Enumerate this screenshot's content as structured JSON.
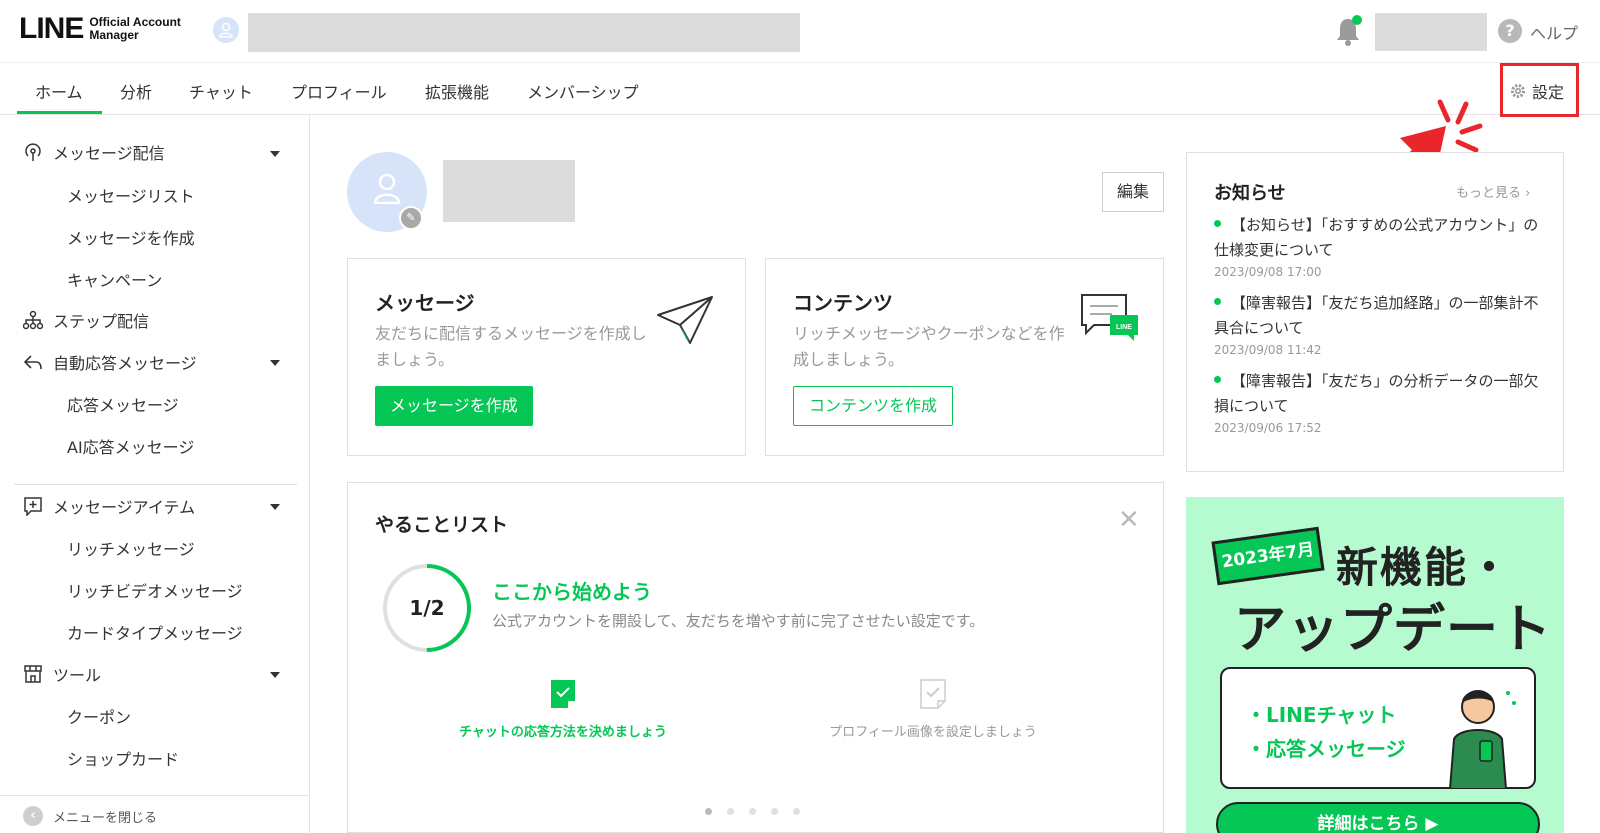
{
  "header": {
    "logo_main": "LINE",
    "logo_sub": "Official Account Manager",
    "help_label": "ヘルプ"
  },
  "tabs": [
    {
      "label": "ホーム",
      "active": true
    },
    {
      "label": "分析"
    },
    {
      "label": "チャット"
    },
    {
      "label": "プロフィール"
    },
    {
      "label": "拡張機能"
    },
    {
      "label": "メンバーシップ"
    }
  ],
  "settings_label": "設定",
  "sidebar": {
    "groups": [
      {
        "label": "メッセージ配信",
        "icon": "broadcast-icon",
        "items": [
          "メッセージリスト",
          "メッセージを作成",
          "キャンペーン"
        ]
      },
      {
        "label": "ステップ配信",
        "icon": "step-icon"
      },
      {
        "label": "自動応答メッセージ",
        "icon": "auto-reply-icon",
        "items": [
          "応答メッセージ",
          "AI応答メッセージ"
        ]
      },
      {
        "label": "メッセージアイテム",
        "icon": "add-item-icon",
        "items": [
          "リッチメッセージ",
          "リッチビデオメッセージ",
          "カードタイプメッセージ"
        ]
      },
      {
        "label": "ツール",
        "icon": "shop-icon",
        "items": [
          "クーポン",
          "ショップカード"
        ]
      }
    ],
    "close_menu": "メニューを閉じる"
  },
  "profile": {
    "edit_label": "編集"
  },
  "cards": {
    "message": {
      "title": "メッセージ",
      "desc": "友だちに配信するメッセージを作成しましょう。",
      "button": "メッセージを作成"
    },
    "content": {
      "title": "コンテンツ",
      "desc": "リッチメッセージやクーポンなどを作成しましょう。",
      "button": "コンテンツを作成"
    }
  },
  "news": {
    "title": "お知らせ",
    "more": "もっと見る",
    "items": [
      {
        "text": "【お知らせ】「おすすめの公式アカウント」の仕様変更について",
        "date": "2023/09/08 17:00"
      },
      {
        "text": "【障害報告】「友だち追加経路」の一部集計不具合について",
        "date": "2023/09/08 11:42"
      },
      {
        "text": "【障害報告】「友だち」の分析データの一部欠損について",
        "date": "2023/09/06 17:52"
      }
    ]
  },
  "banner": {
    "tag": "2023年7月",
    "headline1": "新機能・",
    "headline2": "アップデート",
    "line1": "・LINEチャット",
    "line2": "・応答メッセージ",
    "button": "詳細はこちら ▶"
  },
  "todo": {
    "title": "やることリスト",
    "progress_text": "1/2",
    "progress_fraction": 0.5,
    "heading": "ここから始めよう",
    "sub": "公式アカウントを開設して、友だちを増やす前に完了させたい設定です。",
    "steps": [
      {
        "label": "チャットの応答方法を決めましょう",
        "done": true
      },
      {
        "label": "プロフィール画像を設定しましょう",
        "done": false
      }
    ],
    "page_count": 5,
    "active_page": 1
  },
  "colors": {
    "brand": "#06c755",
    "highlight": "#e8262b",
    "banner_bg": "#b6fad0"
  }
}
